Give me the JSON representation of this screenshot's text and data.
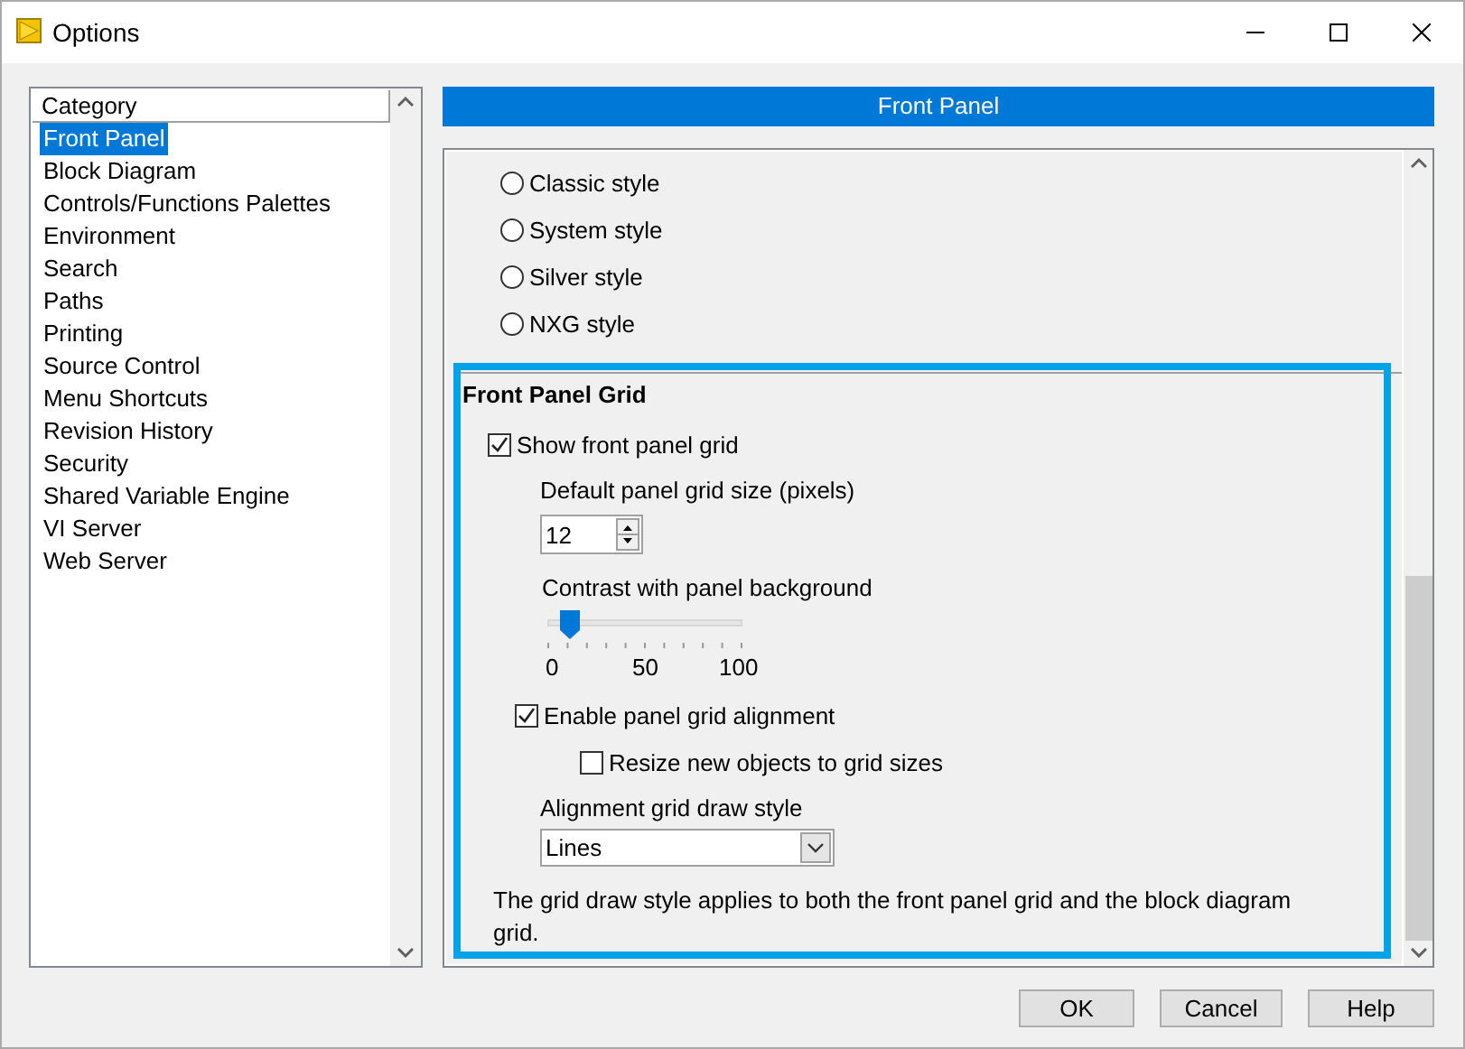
{
  "window": {
    "title": "Options"
  },
  "category_list": {
    "header": "Category",
    "items": [
      {
        "label": "Front Panel",
        "selected": true
      },
      {
        "label": "Block Diagram",
        "selected": false
      },
      {
        "label": "Controls/Functions Palettes",
        "selected": false
      },
      {
        "label": "Environment",
        "selected": false
      },
      {
        "label": "Search",
        "selected": false
      },
      {
        "label": "Paths",
        "selected": false
      },
      {
        "label": "Printing",
        "selected": false
      },
      {
        "label": "Source Control",
        "selected": false
      },
      {
        "label": "Menu Shortcuts",
        "selected": false
      },
      {
        "label": "Revision History",
        "selected": false
      },
      {
        "label": "Security",
        "selected": false
      },
      {
        "label": "Shared Variable Engine",
        "selected": false
      },
      {
        "label": "VI Server",
        "selected": false
      },
      {
        "label": "Web Server",
        "selected": false
      }
    ]
  },
  "panel": {
    "title": "Front Panel",
    "styles": [
      {
        "label": "Classic style",
        "selected": false
      },
      {
        "label": "System style",
        "selected": false
      },
      {
        "label": "Silver style",
        "selected": false
      },
      {
        "label": "NXG style",
        "selected": false
      }
    ],
    "grid_section": {
      "title": "Front Panel Grid",
      "show_grid": {
        "label": "Show front panel grid",
        "checked": true
      },
      "grid_size": {
        "label": "Default panel grid size (pixels)",
        "value": "12"
      },
      "contrast": {
        "label": "Contrast with panel background",
        "level": 0.12,
        "ticks": [
          "0",
          "50",
          "100"
        ]
      },
      "enable_alignment": {
        "label": "Enable panel grid alignment",
        "checked": true
      },
      "resize": {
        "label": "Resize new objects to grid sizes",
        "checked": false
      },
      "draw_style": {
        "label": "Alignment grid draw style",
        "value": "Lines"
      },
      "note": "The grid draw style applies to both the front panel grid and the block diagram grid."
    }
  },
  "buttons": [
    "OK",
    "Cancel",
    "Help"
  ]
}
